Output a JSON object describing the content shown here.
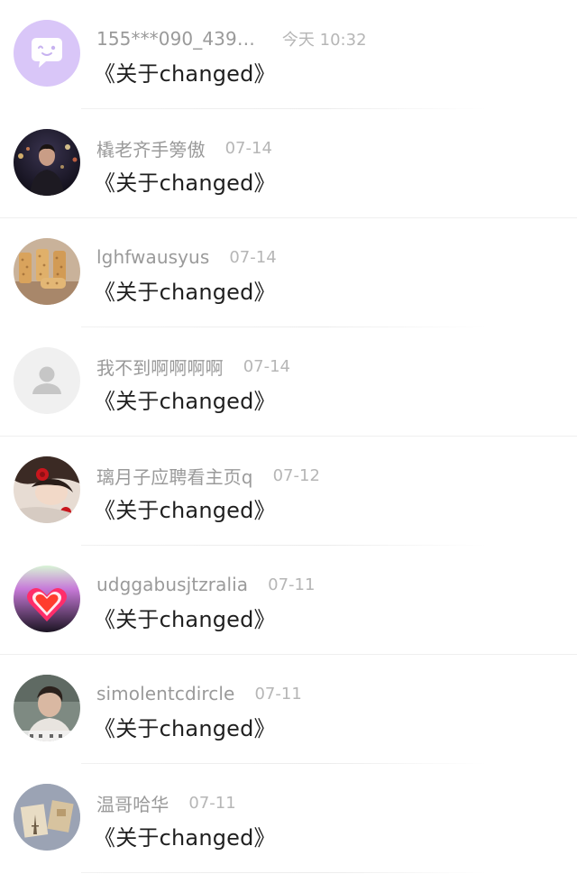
{
  "comments": [
    {
      "avatar": "purple-chat-bubble-icon",
      "username": "155***090_439…",
      "time": "今天 10:32",
      "message": "《关于changed》"
    },
    {
      "avatar": "night-city-portrait",
      "username": "橇老齐手篣傲",
      "time": "07-14",
      "message": "《关于changed》"
    },
    {
      "avatar": "cork-jars-photo",
      "username": "lghfwausyus",
      "time": "07-14",
      "message": "《关于changed》"
    },
    {
      "avatar": "default-user-icon",
      "username": "我不到啊啊啊啊",
      "time": "07-14",
      "message": "《关于changed》"
    },
    {
      "avatar": "girl-with-red-flower-photo",
      "username": "璃月子应聘看主页q",
      "time": "07-12",
      "message": "《关于changed》"
    },
    {
      "avatar": "neon-heart-photo",
      "username": "udggabusjtzralia",
      "time": "07-11",
      "message": "《关于changed》"
    },
    {
      "avatar": "man-portrait-photo",
      "username": "simolentcdircle",
      "time": "07-11",
      "message": "《关于changed》"
    },
    {
      "avatar": "eiffel-tower-postcard-photo",
      "username": "温哥哈华",
      "time": "07-11",
      "message": "《关于changed》"
    }
  ],
  "colors": {
    "username": "#9a9a9a",
    "time": "#b6b6b6",
    "message": "#1f1f1f",
    "divider": "#efefef",
    "avatar_purple": "#d7c4f7"
  }
}
